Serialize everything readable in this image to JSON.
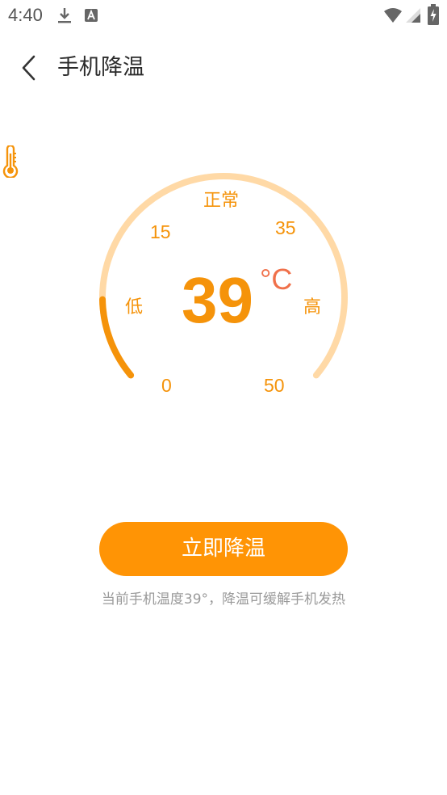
{
  "status_bar": {
    "time": "4:40",
    "icons": [
      "download-icon",
      "text-notification-icon",
      "wifi-icon",
      "signal-icon",
      "battery-charging-icon"
    ]
  },
  "header": {
    "back_icon": "chevron-left-icon",
    "title": "手机降温"
  },
  "gauge": {
    "status_label": "正常",
    "low_label": "低",
    "high_label": "高",
    "tick_0": "0",
    "tick_15": "15",
    "tick_35": "35",
    "tick_50": "50",
    "temperature": "39",
    "unit": "°C",
    "min": 0,
    "max": 50,
    "current": 39,
    "fill_fraction": 0.15,
    "track_color": "#ffd9a6",
    "fill_color": "#f5930a",
    "text_color": "#f5930a",
    "unit_color": "#f0704a"
  },
  "action": {
    "button_label": "立即降温",
    "button_color": "#ff9405",
    "hint": "当前手机温度39°，降温可缓解手机发热"
  }
}
